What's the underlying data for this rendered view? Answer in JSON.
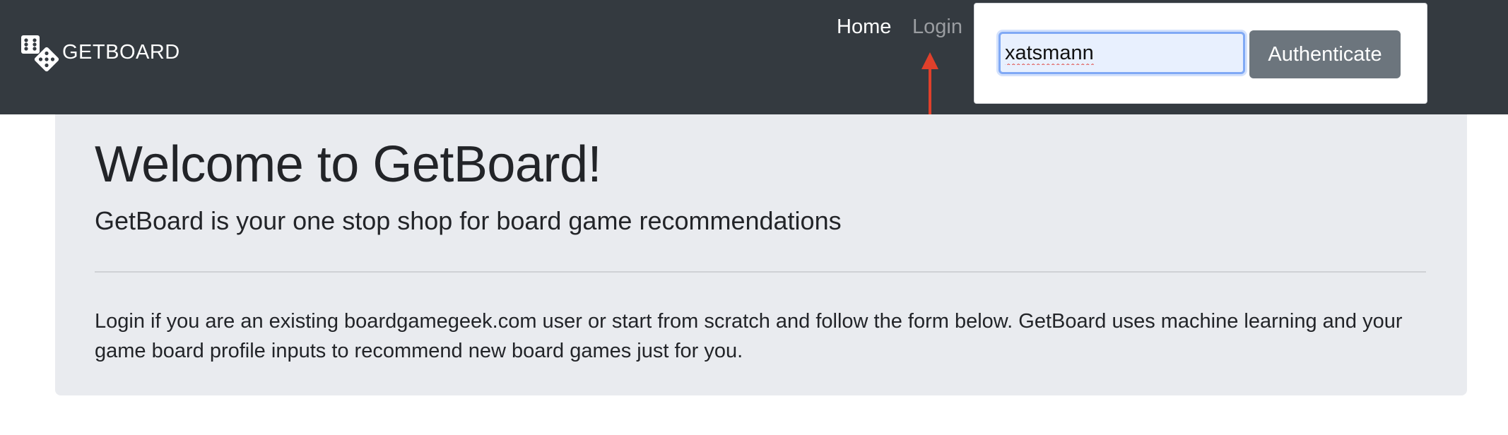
{
  "navbar": {
    "brand_text": "GETBOARD",
    "brand_icon": "dice-icon",
    "links": [
      {
        "label": "Home"
      },
      {
        "label": "Login"
      }
    ]
  },
  "login_form": {
    "username_value": "xatsmann",
    "authenticate_label": "Authenticate"
  },
  "annotation": {
    "arrow_color": "#e0402b",
    "arrow_icon": "up-arrow-icon"
  },
  "jumbotron": {
    "title": "Welcome to GetBoard!",
    "lead": "GetBoard is your one stop shop for board game recommendations",
    "body": "Login if you are an existing boardgamegeek.com user or start from scratch and follow the form below. GetBoard uses machine learning and your game board profile inputs to recommend new board games just for you."
  },
  "colors": {
    "navbar_bg": "#343a40",
    "jumbotron_bg": "#e9ebef",
    "button_bg": "#6c757d",
    "input_focus": "#80a9f5"
  }
}
